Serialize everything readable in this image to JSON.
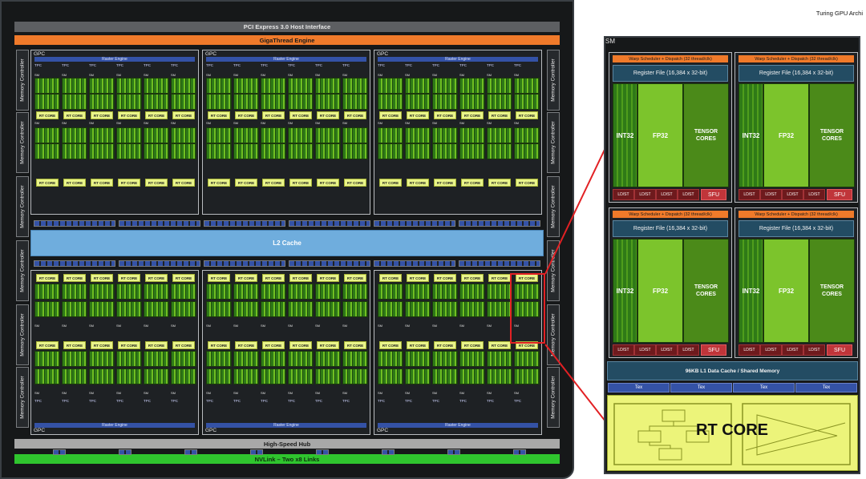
{
  "title_right": "Turing GPU Archi",
  "chip": {
    "pcie": "PCI Express 3.0 Host Interface",
    "giga": "GigaThread Engine",
    "l2": "L2 Cache",
    "hub": "High-Speed Hub",
    "nvlink": "NVLink – Two x8 Links",
    "memory_controller": "Memory Controller",
    "gpc_label": "GPC",
    "raster_engine": "Raster Engine",
    "tpc_label": "TPC",
    "sm_label": "SM",
    "rt_core": "RT CORE"
  },
  "sm": {
    "tag": "SM",
    "warp": "Warp Scheduler + Dispatch (32 thread/clk)",
    "regfile": "Register File (16,384 x 32-bit)",
    "int32": "INT32",
    "fp32": "FP32",
    "tensor": "TENSOR CORES",
    "ldst": "LD/ST",
    "sfu": "SFU",
    "l1": "96KB L1 Data Cache / Shared Memory",
    "tex": "Tex",
    "rt_core": "RT CORE"
  },
  "colors": {
    "giga": "#f07a2a",
    "nvlink": "#2fc52e",
    "l2": "#6faddd",
    "raster": "#3452a6",
    "rt_core": "#e9f48a",
    "highlight": "#e22124"
  }
}
